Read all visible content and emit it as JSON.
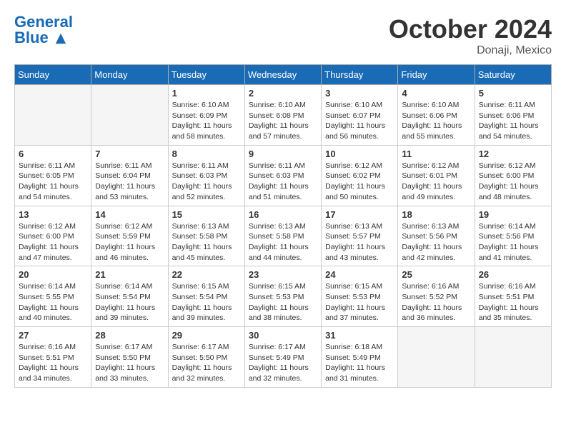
{
  "header": {
    "logo_general": "General",
    "logo_blue": "Blue",
    "month": "October 2024",
    "location": "Donaji, Mexico"
  },
  "weekdays": [
    "Sunday",
    "Monday",
    "Tuesday",
    "Wednesday",
    "Thursday",
    "Friday",
    "Saturday"
  ],
  "weeks": [
    [
      {
        "day": "",
        "empty": true
      },
      {
        "day": "",
        "empty": true
      },
      {
        "day": "1",
        "sunrise": "Sunrise: 6:10 AM",
        "sunset": "Sunset: 6:09 PM",
        "daylight": "Daylight: 11 hours and 58 minutes."
      },
      {
        "day": "2",
        "sunrise": "Sunrise: 6:10 AM",
        "sunset": "Sunset: 6:08 PM",
        "daylight": "Daylight: 11 hours and 57 minutes."
      },
      {
        "day": "3",
        "sunrise": "Sunrise: 6:10 AM",
        "sunset": "Sunset: 6:07 PM",
        "daylight": "Daylight: 11 hours and 56 minutes."
      },
      {
        "day": "4",
        "sunrise": "Sunrise: 6:10 AM",
        "sunset": "Sunset: 6:06 PM",
        "daylight": "Daylight: 11 hours and 55 minutes."
      },
      {
        "day": "5",
        "sunrise": "Sunrise: 6:11 AM",
        "sunset": "Sunset: 6:06 PM",
        "daylight": "Daylight: 11 hours and 54 minutes."
      }
    ],
    [
      {
        "day": "6",
        "sunrise": "Sunrise: 6:11 AM",
        "sunset": "Sunset: 6:05 PM",
        "daylight": "Daylight: 11 hours and 54 minutes."
      },
      {
        "day": "7",
        "sunrise": "Sunrise: 6:11 AM",
        "sunset": "Sunset: 6:04 PM",
        "daylight": "Daylight: 11 hours and 53 minutes."
      },
      {
        "day": "8",
        "sunrise": "Sunrise: 6:11 AM",
        "sunset": "Sunset: 6:03 PM",
        "daylight": "Daylight: 11 hours and 52 minutes."
      },
      {
        "day": "9",
        "sunrise": "Sunrise: 6:11 AM",
        "sunset": "Sunset: 6:03 PM",
        "daylight": "Daylight: 11 hours and 51 minutes."
      },
      {
        "day": "10",
        "sunrise": "Sunrise: 6:12 AM",
        "sunset": "Sunset: 6:02 PM",
        "daylight": "Daylight: 11 hours and 50 minutes."
      },
      {
        "day": "11",
        "sunrise": "Sunrise: 6:12 AM",
        "sunset": "Sunset: 6:01 PM",
        "daylight": "Daylight: 11 hours and 49 minutes."
      },
      {
        "day": "12",
        "sunrise": "Sunrise: 6:12 AM",
        "sunset": "Sunset: 6:00 PM",
        "daylight": "Daylight: 11 hours and 48 minutes."
      }
    ],
    [
      {
        "day": "13",
        "sunrise": "Sunrise: 6:12 AM",
        "sunset": "Sunset: 6:00 PM",
        "daylight": "Daylight: 11 hours and 47 minutes."
      },
      {
        "day": "14",
        "sunrise": "Sunrise: 6:12 AM",
        "sunset": "Sunset: 5:59 PM",
        "daylight": "Daylight: 11 hours and 46 minutes."
      },
      {
        "day": "15",
        "sunrise": "Sunrise: 6:13 AM",
        "sunset": "Sunset: 5:58 PM",
        "daylight": "Daylight: 11 hours and 45 minutes."
      },
      {
        "day": "16",
        "sunrise": "Sunrise: 6:13 AM",
        "sunset": "Sunset: 5:58 PM",
        "daylight": "Daylight: 11 hours and 44 minutes."
      },
      {
        "day": "17",
        "sunrise": "Sunrise: 6:13 AM",
        "sunset": "Sunset: 5:57 PM",
        "daylight": "Daylight: 11 hours and 43 minutes."
      },
      {
        "day": "18",
        "sunrise": "Sunrise: 6:13 AM",
        "sunset": "Sunset: 5:56 PM",
        "daylight": "Daylight: 11 hours and 42 minutes."
      },
      {
        "day": "19",
        "sunrise": "Sunrise: 6:14 AM",
        "sunset": "Sunset: 5:56 PM",
        "daylight": "Daylight: 11 hours and 41 minutes."
      }
    ],
    [
      {
        "day": "20",
        "sunrise": "Sunrise: 6:14 AM",
        "sunset": "Sunset: 5:55 PM",
        "daylight": "Daylight: 11 hours and 40 minutes."
      },
      {
        "day": "21",
        "sunrise": "Sunrise: 6:14 AM",
        "sunset": "Sunset: 5:54 PM",
        "daylight": "Daylight: 11 hours and 39 minutes."
      },
      {
        "day": "22",
        "sunrise": "Sunrise: 6:15 AM",
        "sunset": "Sunset: 5:54 PM",
        "daylight": "Daylight: 11 hours and 39 minutes."
      },
      {
        "day": "23",
        "sunrise": "Sunrise: 6:15 AM",
        "sunset": "Sunset: 5:53 PM",
        "daylight": "Daylight: 11 hours and 38 minutes."
      },
      {
        "day": "24",
        "sunrise": "Sunrise: 6:15 AM",
        "sunset": "Sunset: 5:53 PM",
        "daylight": "Daylight: 11 hours and 37 minutes."
      },
      {
        "day": "25",
        "sunrise": "Sunrise: 6:16 AM",
        "sunset": "Sunset: 5:52 PM",
        "daylight": "Daylight: 11 hours and 36 minutes."
      },
      {
        "day": "26",
        "sunrise": "Sunrise: 6:16 AM",
        "sunset": "Sunset: 5:51 PM",
        "daylight": "Daylight: 11 hours and 35 minutes."
      }
    ],
    [
      {
        "day": "27",
        "sunrise": "Sunrise: 6:16 AM",
        "sunset": "Sunset: 5:51 PM",
        "daylight": "Daylight: 11 hours and 34 minutes."
      },
      {
        "day": "28",
        "sunrise": "Sunrise: 6:17 AM",
        "sunset": "Sunset: 5:50 PM",
        "daylight": "Daylight: 11 hours and 33 minutes."
      },
      {
        "day": "29",
        "sunrise": "Sunrise: 6:17 AM",
        "sunset": "Sunset: 5:50 PM",
        "daylight": "Daylight: 11 hours and 32 minutes."
      },
      {
        "day": "30",
        "sunrise": "Sunrise: 6:17 AM",
        "sunset": "Sunset: 5:49 PM",
        "daylight": "Daylight: 11 hours and 32 minutes."
      },
      {
        "day": "31",
        "sunrise": "Sunrise: 6:18 AM",
        "sunset": "Sunset: 5:49 PM",
        "daylight": "Daylight: 11 hours and 31 minutes."
      },
      {
        "day": "",
        "empty": true
      },
      {
        "day": "",
        "empty": true
      }
    ]
  ]
}
